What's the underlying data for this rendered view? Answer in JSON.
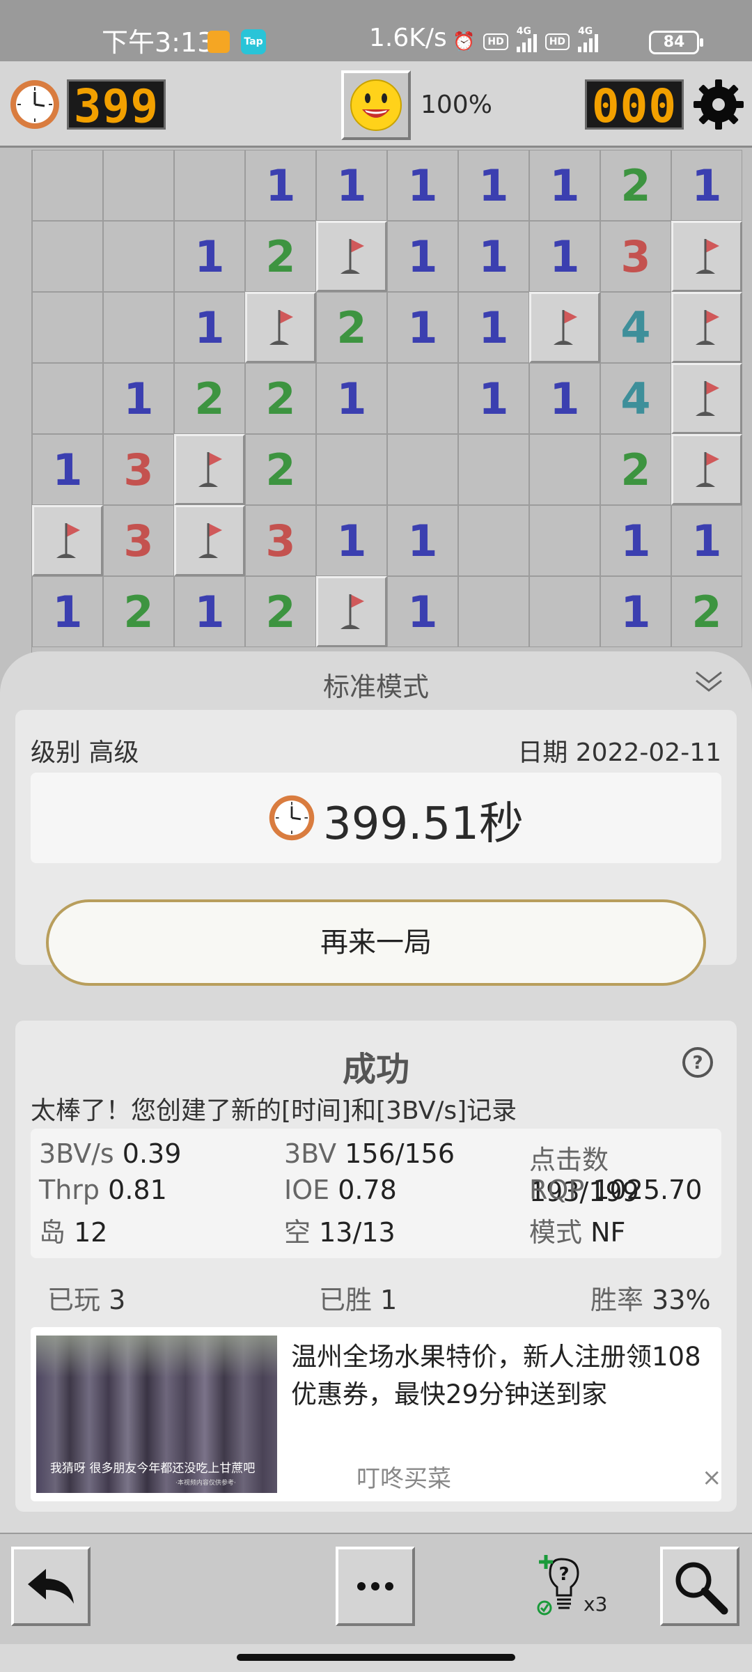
{
  "status_bar": {
    "time": "下午3:13",
    "app_badge": "Tap",
    "net_speed": "1.6K/s",
    "hd_label": "HD",
    "net_type": "4G",
    "battery": "84"
  },
  "game_header": {
    "timer": "399",
    "mines_left": "000",
    "progress": "100%",
    "icons": [
      "clock-icon",
      "smiley-icon",
      "gear-icon"
    ]
  },
  "board": {
    "rows": [
      [
        "",
        "",
        "",
        "1",
        "1",
        "1",
        "1",
        "1",
        "2",
        "1"
      ],
      [
        "",
        "",
        "1",
        "2",
        "F",
        "1",
        "1",
        "1",
        "3",
        "F"
      ],
      [
        "",
        "",
        "1",
        "F",
        "2",
        "1",
        "1",
        "F",
        "4",
        "F"
      ],
      [
        "",
        "1",
        "2",
        "2",
        "1",
        "",
        "1",
        "1",
        "4",
        "F"
      ],
      [
        "1",
        "3",
        "F",
        "2",
        "",
        "",
        "",
        "",
        "2",
        "F"
      ],
      [
        "F",
        "3",
        "F",
        "3",
        "1",
        "1",
        "",
        "",
        "1",
        "1"
      ],
      [
        "1",
        "2",
        "1",
        "2",
        "F",
        "1",
        "",
        "",
        "1",
        "2"
      ]
    ],
    "number_colors": {
      "1": "#3b3fb0",
      "2": "#3d9440",
      "3": "#c4524f",
      "4": "#3e8f9a"
    }
  },
  "result_sheet": {
    "mode_title": "标准模式",
    "level_label": "级别",
    "level_value": "高级",
    "date_label": "日期",
    "date_value": "2022-02-11",
    "time_value": "399.51秒",
    "play_again": "再来一局",
    "result_title": "成功",
    "record_msg": "太棒了！您创建了新的[时间]和[3BV/s]记录",
    "stats": [
      {
        "k": "3BV/s",
        "v": "0.39"
      },
      {
        "k": "3BV",
        "v": "156/156"
      },
      {
        "k": "点击数",
        "v": "193/199"
      },
      {
        "k": "Thrp",
        "v": "0.81"
      },
      {
        "k": "IOE",
        "v": "0.78"
      },
      {
        "k": "RQP",
        "v": "1025.70"
      },
      {
        "k": "岛",
        "v": "12"
      },
      {
        "k": "空",
        "v": "13/13"
      },
      {
        "k": "模式",
        "v": "NF"
      }
    ],
    "played_label": "已玩",
    "played_value": "3",
    "won_label": "已胜",
    "won_value": "1",
    "rate_label": "胜率",
    "rate_value": "33%"
  },
  "ad": {
    "text": "温州全场水果特价，新人注册领108优惠券，最快29分钟送到家",
    "brand": "叮咚买菜",
    "close": "×",
    "image_caption": "我猜呀 很多朋友今年都还没吃上甘蔗吧",
    "image_subcaption": "·本视频内容仅供参考·"
  },
  "toolbar": {
    "hint_count": "x3",
    "buttons": [
      "undo-button",
      "more-button",
      "hint-button",
      "search-button"
    ]
  }
}
